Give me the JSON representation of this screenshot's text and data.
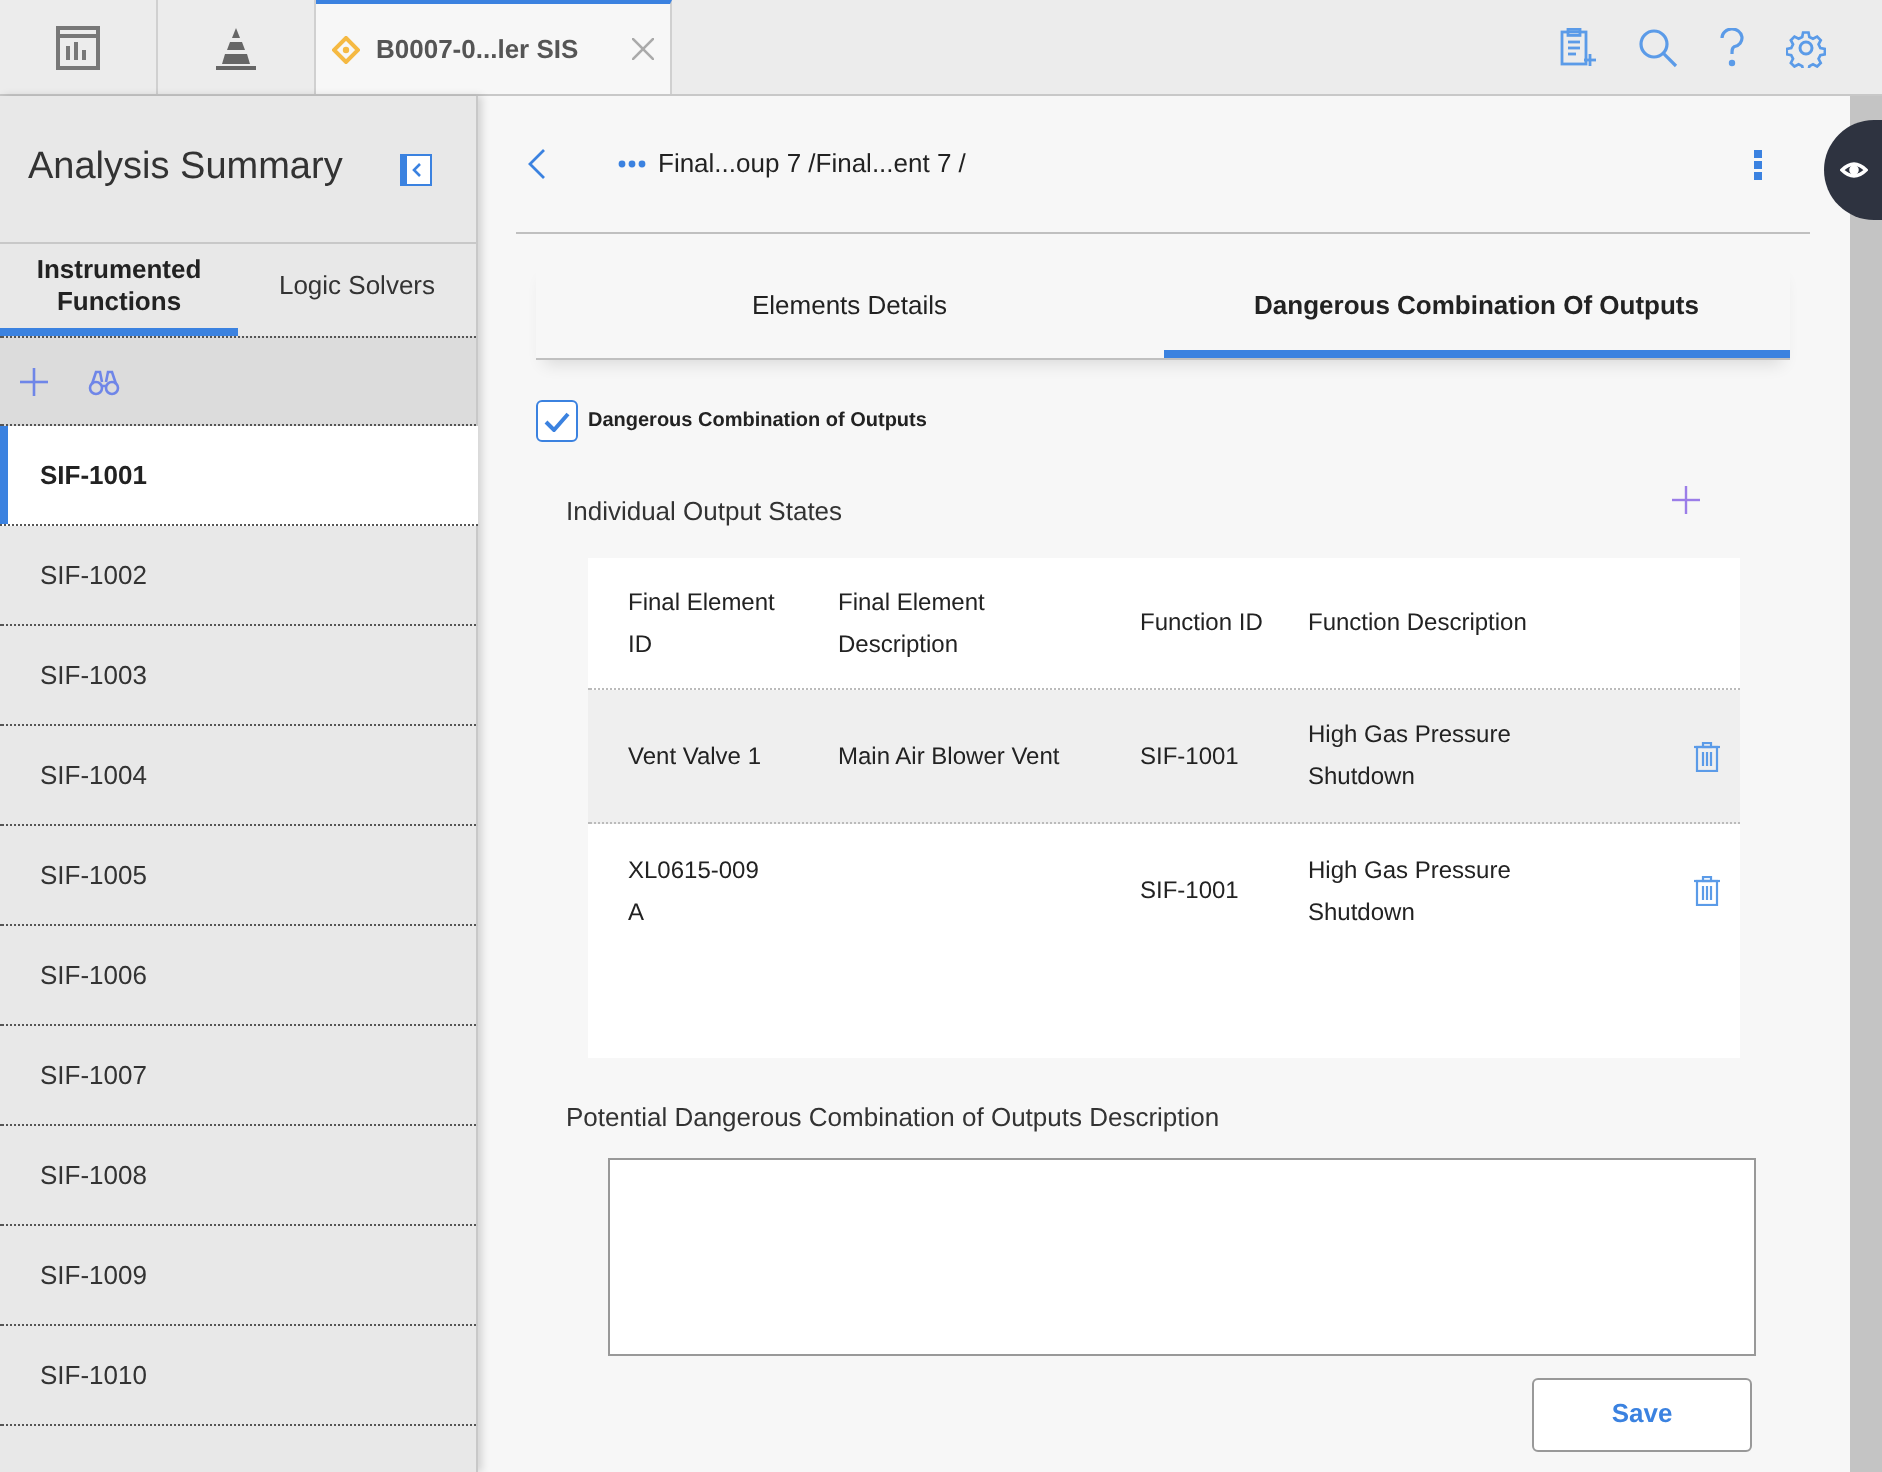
{
  "top_tabs": [
    {
      "kind": "dashboard",
      "selected": false
    },
    {
      "kind": "pyramid",
      "selected": false
    },
    {
      "kind": "document",
      "label": "B0007-0...ler SIS",
      "selected": true
    }
  ],
  "sidebar": {
    "title": "Analysis Summary",
    "tabs": [
      {
        "label": "Instrumented Functions",
        "selected": true
      },
      {
        "label": "Logic Solvers",
        "selected": false
      }
    ],
    "items": [
      {
        "label": "SIF-1001",
        "selected": true
      },
      {
        "label": "SIF-1002",
        "selected": false
      },
      {
        "label": "SIF-1003",
        "selected": false
      },
      {
        "label": "SIF-1004",
        "selected": false
      },
      {
        "label": "SIF-1005",
        "selected": false
      },
      {
        "label": "SIF-1006",
        "selected": false
      },
      {
        "label": "SIF-1007",
        "selected": false
      },
      {
        "label": "SIF-1008",
        "selected": false
      },
      {
        "label": "SIF-1009",
        "selected": false
      },
      {
        "label": "SIF-1010",
        "selected": false
      }
    ]
  },
  "breadcrumb": "Final...oup 7 /Final...ent 7 /",
  "tabs": [
    {
      "label": "Elements Details",
      "selected": false
    },
    {
      "label": "Dangerous Combination Of Outputs",
      "selected": true
    }
  ],
  "checkbox": {
    "label": "Dangerous Combination of Outputs",
    "checked": true
  },
  "section_title": "Individual Output States",
  "table": {
    "columns": [
      "Final Element ID",
      "Final Element Description",
      "Function ID",
      "Function Description"
    ],
    "rows": [
      {
        "cells": [
          "Vent Valve 1",
          "Main Air Blower Vent",
          "SIF-1001",
          "High Gas Pressure Shutdown"
        ],
        "selected": true
      },
      {
        "cells": [
          "XL0615-009 A",
          "",
          "SIF-1001",
          "High Gas Pressure Shutdown"
        ],
        "selected": false
      }
    ]
  },
  "description_label": "Potential Dangerous Combination of Outputs Description",
  "save_button": "Save"
}
